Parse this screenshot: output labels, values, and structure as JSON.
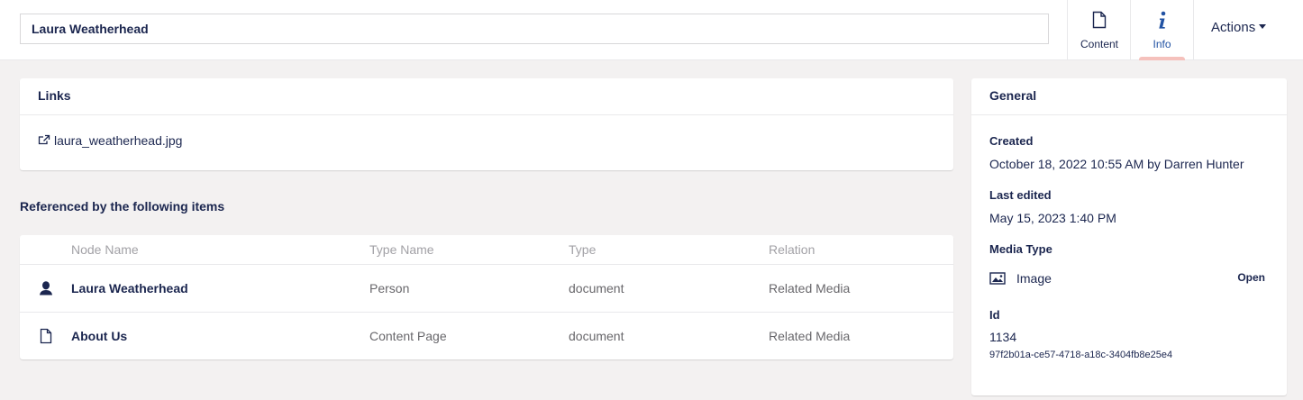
{
  "header": {
    "name_value": "Laura Weatherhead",
    "tabs": [
      {
        "label": "Content",
        "icon": "document-icon"
      },
      {
        "label": "Info",
        "icon": "info-icon"
      }
    ],
    "actions_label": "Actions"
  },
  "links": {
    "title": "Links",
    "items": [
      {
        "label": "laura_weatherhead.jpg",
        "icon": "external-link-icon"
      }
    ]
  },
  "references": {
    "title": "Referenced by the following items",
    "columns": [
      "Node Name",
      "Type Name",
      "Type",
      "Relation"
    ],
    "rows": [
      {
        "icon": "user-icon",
        "name": "Laura Weatherhead",
        "type_name": "Person",
        "type": "document",
        "relation": "Related Media"
      },
      {
        "icon": "document-icon",
        "name": "About Us",
        "type_name": "Content Page",
        "type": "document",
        "relation": "Related Media"
      }
    ]
  },
  "general": {
    "title": "General",
    "created_label": "Created",
    "created_value": "October 18, 2022 10:55 AM by Darren Hunter",
    "edited_label": "Last edited",
    "edited_value": "May 15, 2023 1:40 PM",
    "media_type_label": "Media Type",
    "media_type_value": "Image",
    "open_label": "Open",
    "id_label": "Id",
    "id_value": "1134",
    "guid_value": "97f2b01a-ce57-4718-a18c-3404fb8e25e4"
  },
  "colors": {
    "primary_text": "#1b264f",
    "muted_text": "#68676b",
    "header_text": "#a2a1a6",
    "active_tab": "#2152a3",
    "active_underline": "#f5c1bc",
    "background": "#f3f1f1"
  }
}
